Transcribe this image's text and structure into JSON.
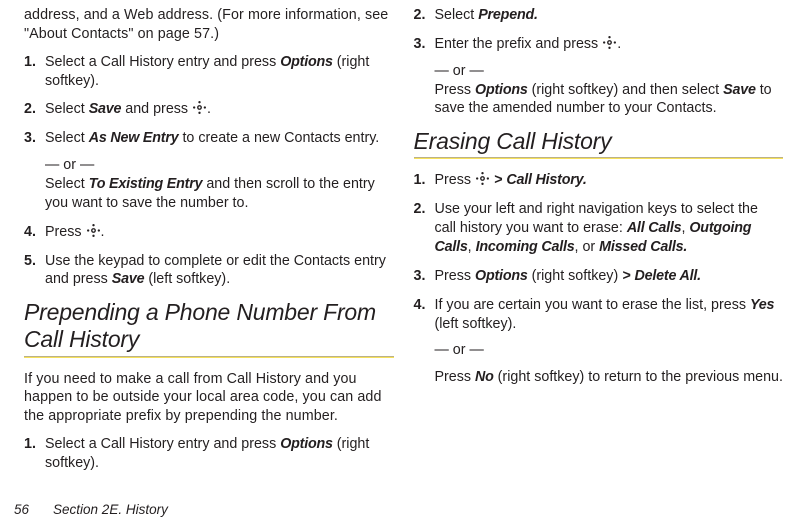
{
  "left": {
    "cont1": "address, and a Web address. (For more information, see \"About Contacts\" on page 57.)",
    "steps": [
      {
        "n": "1.",
        "pre": "Select a Call History entry and press ",
        "opt": "Options",
        "post": " (right softkey)."
      },
      {
        "n": "2.",
        "pre": "Select ",
        "save": "Save",
        "mid": " and press ",
        "dot": "."
      },
      {
        "n": "3.",
        "pre": "Select ",
        "asnew": "As New Entry",
        "post": " to create a new Contacts entry.",
        "orline": "— or —",
        "sub_pre": "Select ",
        "toexist": "To Existing Entry",
        "sub_post": " and then scroll to the entry you want to save the number to."
      },
      {
        "n": "4.",
        "pre": "Press ",
        "dot": "."
      },
      {
        "n": "5.",
        "pre": "Use the keypad to complete or edit the Contacts entry and press ",
        "save": "Save",
        "post": " (left softkey)."
      }
    ],
    "h2a": "Prepending a Phone Number From",
    "h2b": "Call History",
    "intro": "If you need to make a call from Call History and you happen to be outside your local area code, you can add the appropriate prefix by prepending the number.",
    "step1": {
      "n": "1.",
      "pre": "Select a Call History entry and press ",
      "opt": "Options",
      "post": " (right softkey)."
    }
  },
  "right": {
    "steps": [
      {
        "n": "2.",
        "pre": "Select ",
        "prep": "Prepend."
      },
      {
        "n": "3.",
        "pre": "Enter the prefix and press ",
        "dot": ".",
        "orline": "— or —",
        "sub_pre": "Press ",
        "opt": "Options",
        "sub_mid": " (right softkey) and then select ",
        "save": "Save",
        "sub_post": " to save the amended number to your Contacts."
      }
    ],
    "h2": "Erasing Call History",
    "esteps": [
      {
        "n": "1.",
        "pre": "Press ",
        "gt": " > ",
        "ch": "Call History."
      },
      {
        "n": "2.",
        "pre": "Use your left and right navigation keys to select the call history you want to erase: ",
        "a": "All Calls",
        "c1": ", ",
        "b": "Outgoing Calls",
        "c2": ", ",
        "c": "Incoming Calls",
        "c3": ", or ",
        "d": "Missed Calls."
      },
      {
        "n": "3.",
        "pre": "Press ",
        "opt": "Options",
        "mid": " (right softkey) ",
        "gt": "> ",
        "del": "Delete All."
      },
      {
        "n": "4.",
        "pre": "If you are certain you want to erase the list, press ",
        "yes": "Yes",
        "post": " (left softkey).",
        "orline": "— or —",
        "sub_pre": "Press ",
        "no": "No",
        "sub_post": " (right softkey) to return to the previous menu."
      }
    ]
  },
  "footer": {
    "page": "56",
    "section": "Section 2E. History"
  }
}
